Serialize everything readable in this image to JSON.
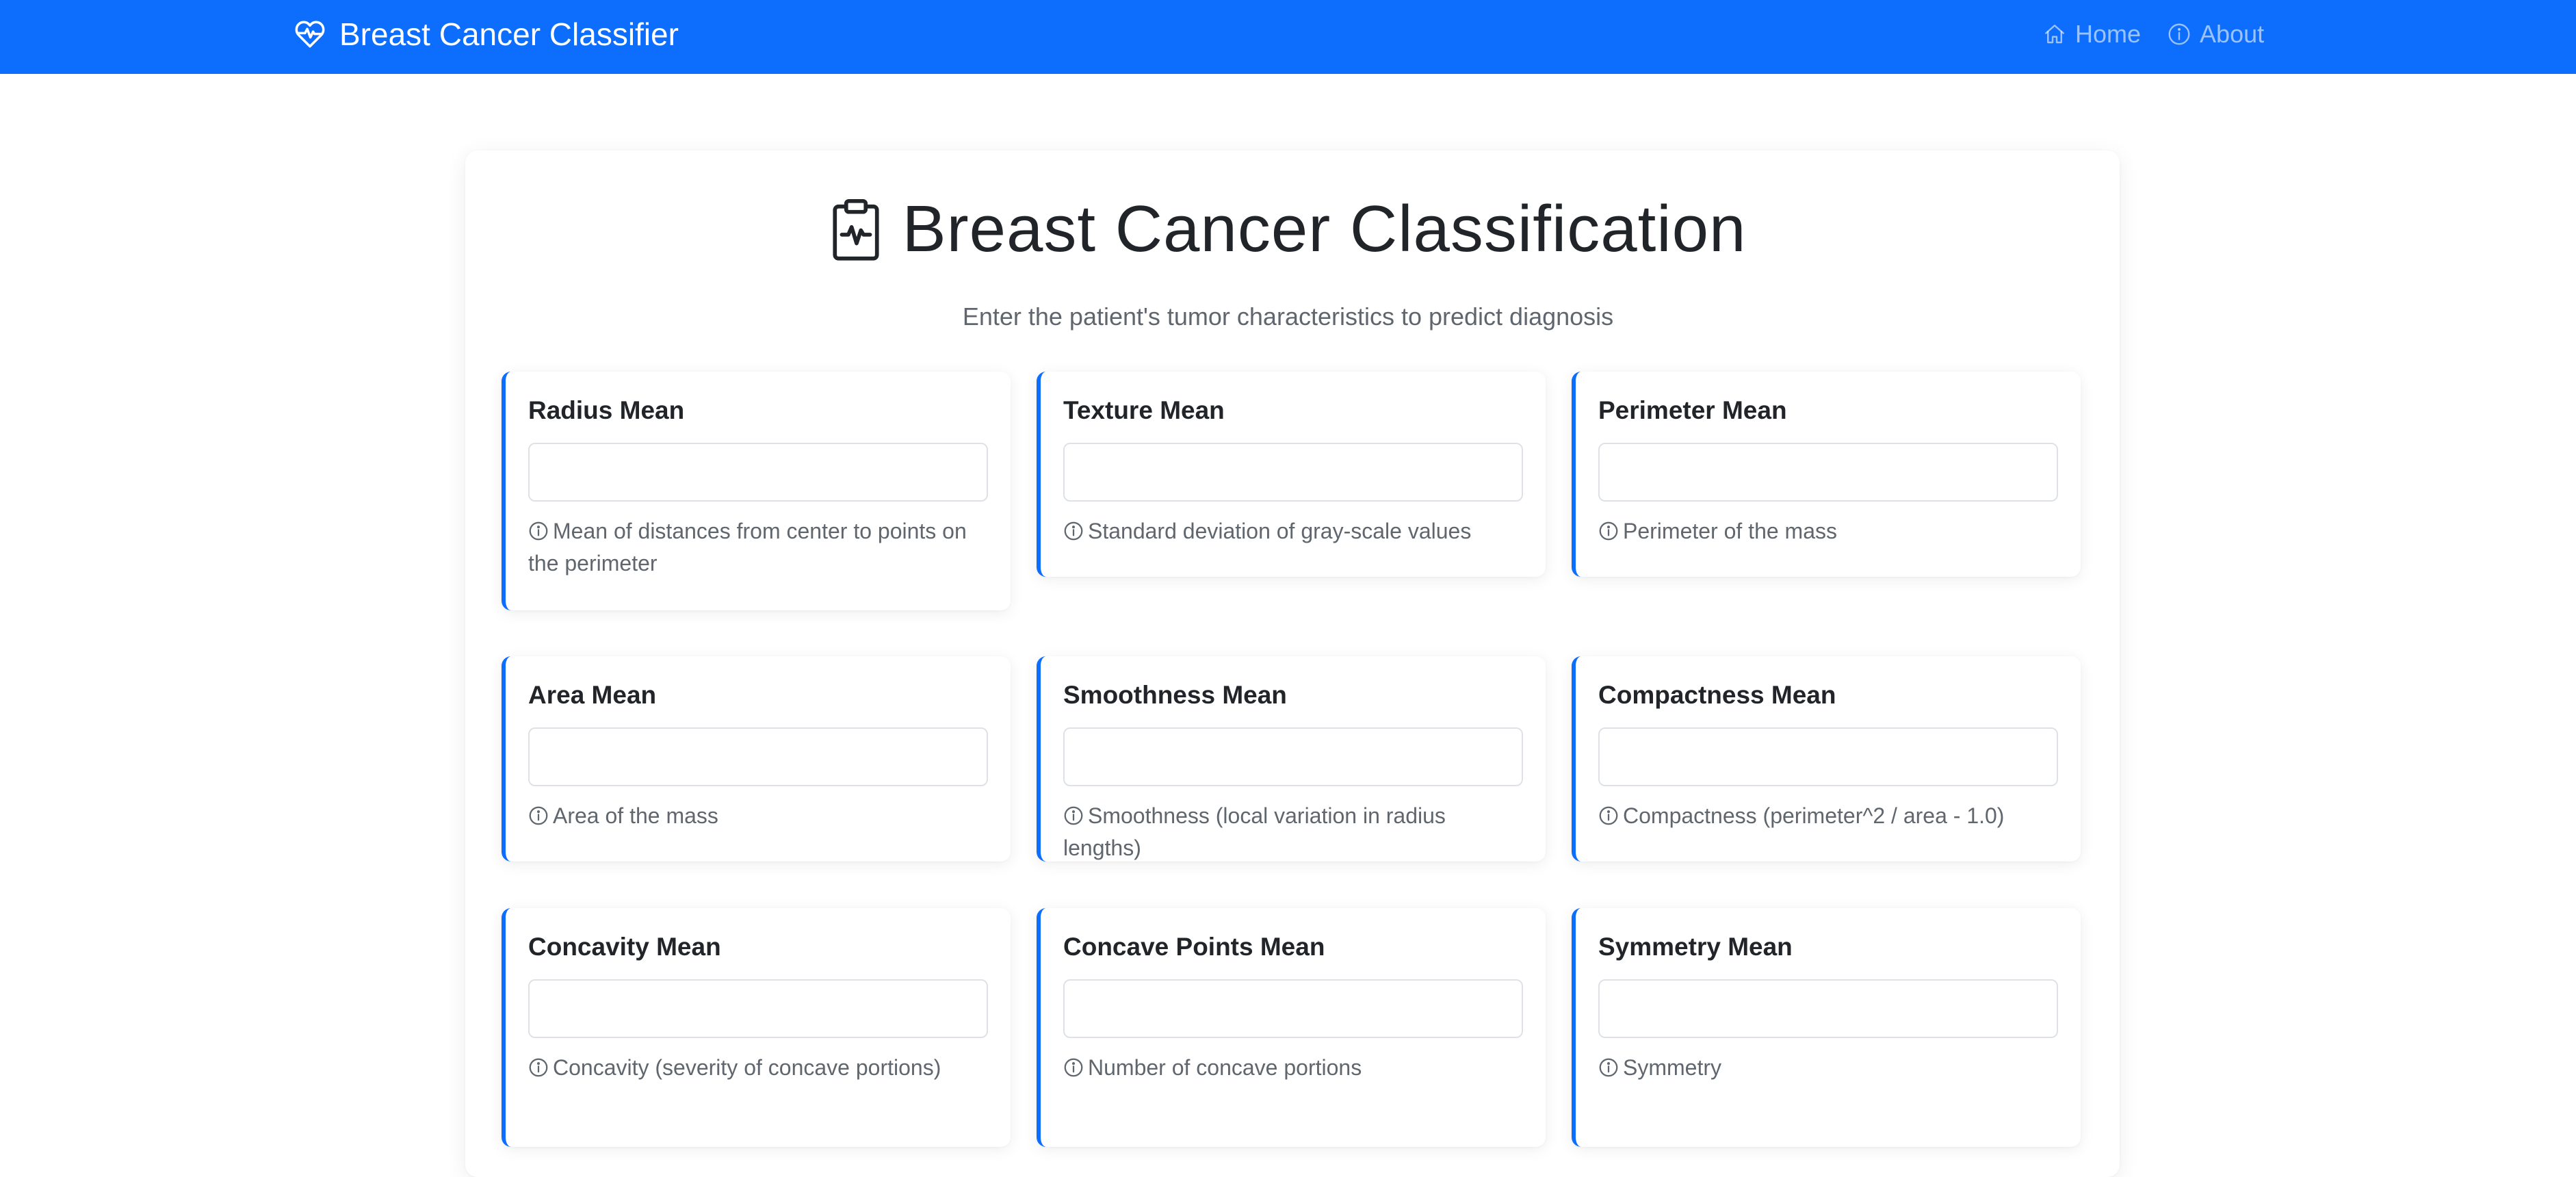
{
  "navbar": {
    "brand": "Breast Cancer Classifier",
    "brand_icon": "heart-pulse-icon",
    "links": [
      {
        "label": "Home",
        "icon": "house-icon"
      },
      {
        "label": "About",
        "icon": "info-circle-icon"
      }
    ],
    "background": "#0d6efd"
  },
  "header": {
    "title": "Breast Cancer Classification",
    "title_icon": "clipboard-pulse-icon",
    "subtitle": "Enter the patient's tumor characteristics to predict diagnosis"
  },
  "fields": [
    {
      "label": "Radius Mean",
      "value": "",
      "help": "Mean of distances from center to points on the perimeter"
    },
    {
      "label": "Texture Mean",
      "value": "",
      "help": "Standard deviation of gray-scale values"
    },
    {
      "label": "Perimeter Mean",
      "value": "",
      "help": "Perimeter of the mass"
    },
    {
      "label": "Area Mean",
      "value": "",
      "help": "Area of the mass"
    },
    {
      "label": "Smoothness Mean",
      "value": "",
      "help": "Smoothness (local variation in radius lengths)"
    },
    {
      "label": "Compactness Mean",
      "value": "",
      "help": "Compactness (perimeter^2 / area - 1.0)"
    },
    {
      "label": "Concavity Mean",
      "value": "",
      "help": "Concavity (severity of concave portions)"
    },
    {
      "label": "Concave Points Mean",
      "value": "",
      "help": "Number of concave portions"
    },
    {
      "label": "Symmetry Mean",
      "value": "",
      "help": "Symmetry"
    }
  ],
  "colors": {
    "accent": "#0d6efd",
    "muted_text": "#5f666d",
    "heading_text": "#212529"
  }
}
